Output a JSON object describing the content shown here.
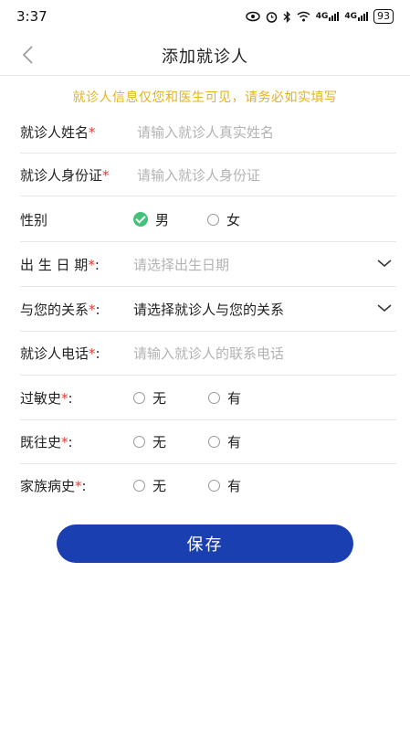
{
  "status_bar": {
    "time": "3:37",
    "battery": "93",
    "net1": "4G",
    "net2": "4G"
  },
  "header": {
    "title": "添加就诊人"
  },
  "notice": "就诊人信息仅您和医生可见，请务必如实填写",
  "form": {
    "name": {
      "label": "就诊人姓名",
      "required": "*",
      "placeholder": "请输入就诊人真实姓名"
    },
    "id_card": {
      "label": "就诊人身份证",
      "required": "*",
      "placeholder": "请输入就诊人身份证"
    },
    "gender": {
      "label": "性别",
      "options": [
        "男",
        "女"
      ],
      "selected": "男"
    },
    "birth": {
      "label": "出 生 日 期",
      "required": "*",
      "colon": ":",
      "placeholder": "请选择出生日期"
    },
    "relation": {
      "label": "与您的关系",
      "required": "*",
      "colon": ":",
      "placeholder": "请选择就诊人与您的关系"
    },
    "phone": {
      "label": "就诊人电话",
      "required": "*",
      "colon": ":",
      "placeholder": "请输入就诊人的联系电话"
    },
    "allergy": {
      "label": "过敏史",
      "required": "*",
      "colon": ":",
      "options": [
        "无",
        "有"
      ]
    },
    "past": {
      "label": "既往史",
      "required": "*",
      "colon": ":",
      "options": [
        "无",
        "有"
      ]
    },
    "family": {
      "label": "家族病史",
      "required": "*",
      "colon": ":",
      "options": [
        "无",
        "有"
      ]
    }
  },
  "save_label": "保存"
}
